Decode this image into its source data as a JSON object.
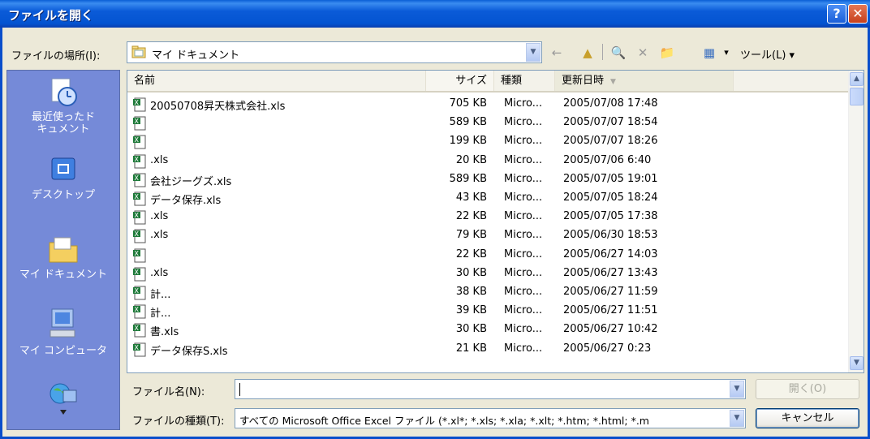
{
  "window": {
    "title": "ファイルを開く",
    "help_button": "?",
    "close_button": "✕"
  },
  "location": {
    "label": "ファイルの場所(I):",
    "value": "マイ ドキュメント"
  },
  "toolbar": {
    "back_icon": "←",
    "up_icon": "▲",
    "search_icon": "🔍",
    "delete_icon": "✕",
    "newfolder_icon": "📁",
    "views_icon": "▦",
    "views_arrow": "▾",
    "tools_label": "ツール(L) ▾"
  },
  "places": [
    {
      "id": "recent",
      "label": "最近使ったド\nキュメント",
      "icon": "recent-documents-icon"
    },
    {
      "id": "desktop",
      "label": "デスクトップ",
      "icon": "desktop-icon"
    },
    {
      "id": "mydocs",
      "label": "マイ ドキュメント",
      "icon": "my-documents-icon"
    },
    {
      "id": "mycomputer",
      "label": "マイ コンピュータ",
      "icon": "my-computer-icon"
    },
    {
      "id": "network",
      "label": "",
      "icon": "network-icon"
    }
  ],
  "columns": {
    "name": "名前",
    "size": "サイズ",
    "type": "種類",
    "date": "更新日時",
    "sort_indicator": "▼"
  },
  "files": [
    {
      "name": "20050708昇天株式会社.xls",
      "size": "705 KB",
      "type": "Micro...",
      "date": "2005/07/08 17:48"
    },
    {
      "name": "",
      "size": "589 KB",
      "type": "Micro...",
      "date": "2005/07/07 18:54"
    },
    {
      "name": "",
      "size": "199 KB",
      "type": "Micro...",
      "date": "2005/07/07 18:26"
    },
    {
      "name": ".xls",
      "size": "20 KB",
      "type": "Micro...",
      "date": "2005/07/06 6:40"
    },
    {
      "name": "会社ジーグズ.xls",
      "size": "589 KB",
      "type": "Micro...",
      "date": "2005/07/05 19:01"
    },
    {
      "name": "データ保存.xls",
      "size": "43 KB",
      "type": "Micro...",
      "date": "2005/07/05 18:24"
    },
    {
      "name": ".xls",
      "size": "22 KB",
      "type": "Micro...",
      "date": "2005/07/05 17:38"
    },
    {
      "name": ".xls",
      "size": "79 KB",
      "type": "Micro...",
      "date": "2005/06/30 18:53"
    },
    {
      "name": "",
      "size": "22 KB",
      "type": "Micro...",
      "date": "2005/06/27 14:03"
    },
    {
      "name": ".xls",
      "size": "30 KB",
      "type": "Micro...",
      "date": "2005/06/27 13:43"
    },
    {
      "name": "計...",
      "size": "38 KB",
      "type": "Micro...",
      "date": "2005/06/27 11:59"
    },
    {
      "name": "計...",
      "size": "39 KB",
      "type": "Micro...",
      "date": "2005/06/27 11:51"
    },
    {
      "name": "書.xls",
      "size": "30 KB",
      "type": "Micro...",
      "date": "2005/06/27 10:42"
    },
    {
      "name": "データ保存S.xls",
      "size": "21 KB",
      "type": "Micro...",
      "date": "2005/06/27 0:23"
    }
  ],
  "filename": {
    "label": "ファイル名(N):",
    "value": ""
  },
  "filetype": {
    "label": "ファイルの種類(T):",
    "value": "すべての Microsoft Office Excel ファイル (*.xl*; *.xls; *.xla; *.xlt; *.htm; *.html; *.m"
  },
  "buttons": {
    "open": "開く(O)",
    "cancel": "キャンセル"
  },
  "colors": {
    "titlebar": "#0454d1",
    "places_bar": "#758ad8",
    "dialog_bg": "#ece9d8"
  }
}
